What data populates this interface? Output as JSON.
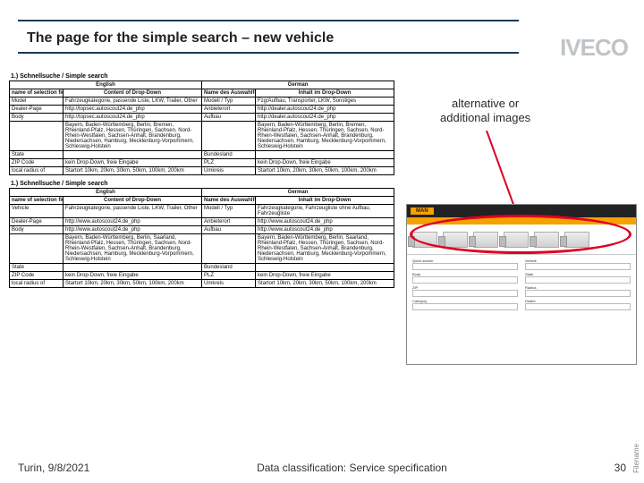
{
  "header": {
    "title": "The page for the simple search – new vehicle",
    "logo": "IVECO"
  },
  "callout": {
    "l1": "alternative or",
    "l2": "additional images"
  },
  "section1": {
    "heading": "1.) Schnellsuche / Simple search",
    "lang_en": "English",
    "lang_de": "German",
    "h_en_name": "name of selection field",
    "h_en_content": "Content of Drop-Down",
    "h_de_name": "Name des Auswahlfelds",
    "h_de_content": "Inhalt im Drop-Down",
    "rows": [
      {
        "en_name": "Model",
        "en_content": "Fahrzeugkategorie, passende Liste, LKW, Trailer, Other",
        "de_name": "Modell / Typ",
        "de_content": "Fzg/Aufbau, Transporter, LKW, Sonstiges"
      },
      {
        "en_name": "Dealer-Page",
        "en_content": "http://topsec.autoscout24.de_php",
        "de_name": "Anbieterort",
        "de_content": "http://dealer.autoscout24.de_php"
      },
      {
        "en_name": "Body",
        "en_content": "http://topsec.autoscout24.de_php",
        "de_name": "Aufbau",
        "de_content": "http://dealer.autoscout24.de_php"
      },
      {
        "en_name": "",
        "en_content": "Bayern, Baden-Württemberg, Berlin, Bremen, Rheinland-Pfalz, Hessen, Thüringen, Sachsen, Nord-Rhein-Westfalen, Sachsen-Anhalt, Brandenburg, Niedersachsen, Hamburg, Mecklenburg-Vorpommern, Schleswig-Holstein",
        "de_name": "",
        "de_content": "Bayern, Baden-Württemberg, Berlin, Bremen, Rheinland-Pfalz, Hessen, Thüringen, Sachsen, Nord-Rhein-Westfalen, Sachsen-Anhalt, Brandenburg, Niedersachsen, Hamburg, Mecklenburg-Vorpommern, Schleswig-Holstein"
      },
      {
        "en_name": "State",
        "en_content": "",
        "de_name": "Bundesland",
        "de_content": ""
      },
      {
        "en_name": "ZIP Code",
        "en_content": "kein Drop-Down, freie Eingabe",
        "de_name": "PLZ",
        "de_content": "kein Drop-Down, freie Eingabe"
      },
      {
        "en_name": "local radius of",
        "en_content": "Startort 10km, 20km, 30km, 50km, 100km, 200km",
        "de_name": "Umkreis",
        "de_content": "Startort 10km, 20km, 30km, 50km, 100km, 200km"
      }
    ]
  },
  "section2": {
    "heading": "1.) Schnellsuche / Simple search",
    "lang_en": "English",
    "lang_de": "German",
    "h_en_name": "name of selection field",
    "h_en_content": "Content of Drop-Down",
    "h_de_name": "Name des Auswahlfelds",
    "h_de_content": "Inhalt im Drop-Down",
    "rows": [
      {
        "en_name": "Vehicle",
        "en_content": "Fahrzeugkategorie, passende Liste, LKW, Trailer, Other",
        "de_name": "Modell / Typ",
        "de_content": "Fahrzeugkategorie, Fahrzeugliste ohne Aufbau, Fahrzeugliste"
      },
      {
        "en_name": "Dealer-Page",
        "en_content": "http://www.autoscout24.de_php",
        "de_name": "Anbieterort",
        "de_content": "http://www.autoscout24.de_php"
      },
      {
        "en_name": "Body",
        "en_content": "http://www.autoscout24.de_php",
        "de_name": "Aufbau",
        "de_content": "http://www.autoscout24.de_php"
      },
      {
        "en_name": "",
        "en_content": "Bayern, Baden-Württemberg, Berlin, Saarland, Rheinland-Pfalz, Hessen, Thüringen, Sachsen, Nord-Rhein-Westfalen, Sachsen-Anhalt, Brandenburg, Niedersachsen, Hamburg, Mecklenburg-Vorpommern, Schleswig-Holstein",
        "de_name": "",
        "de_content": "Bayern, Baden-Württemberg, Berlin, Saarland, Rheinland-Pfalz, Hessen, Thüringen, Sachsen, Nord-Rhein-Westfalen, Sachsen-Anhalt, Brandenburg, Niedersachsen, Hamburg, Mecklenburg-Vorpommern, Schleswig-Holstein"
      },
      {
        "en_name": "State",
        "en_content": "",
        "de_name": "Bundesland",
        "de_content": ""
      },
      {
        "en_name": "ZIP Code",
        "en_content": "kein Drop-Down, freie Eingabe",
        "de_name": "PLZ",
        "de_content": "kein Drop-Down, freie Eingabe"
      },
      {
        "en_name": "local radius of",
        "en_content": "Startort 10km, 20km, 30km, 50km, 100km, 200km",
        "de_name": "Umkreis",
        "de_content": "Startort 10km, 20km, 30km, 50km, 100km, 200km"
      }
    ]
  },
  "thumb": {
    "brand": "MAN",
    "form_labels": [
      "Quick search",
      "Vehicle",
      "Body",
      "State",
      "ZIP",
      "Radius",
      "Category",
      "Dealer"
    ]
  },
  "footer": {
    "location_date": "Turin, 9/8/2021",
    "classification": "Data classification: Service specification",
    "page": "30",
    "filename_label": "Filename"
  }
}
